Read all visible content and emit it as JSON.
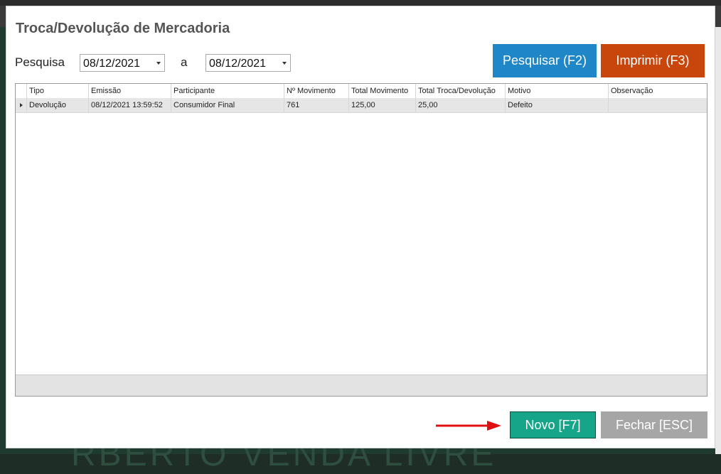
{
  "background": {
    "watermark": "RBERTO VENDA LIVRE",
    "accent": "#1f3a2e"
  },
  "dialog": {
    "title": "Troca/Devolução de Mercadoria"
  },
  "filters": {
    "search_label": "Pesquisa",
    "date_from": "08/12/2021",
    "separator": "a",
    "date_to": "08/12/2021"
  },
  "buttons": {
    "search": "Pesquisar (F2)",
    "print": "Imprimir (F3)",
    "new": "Novo [F7]",
    "close": "Fechar [ESC]"
  },
  "colors": {
    "search_button": "#1f86c8",
    "print_button": "#c8460c",
    "new_button": "#17a589",
    "close_button": "#a6a6a6",
    "arrow": "#e01010"
  },
  "grid": {
    "columns": [
      "Tipo",
      "Emissão",
      "Participante",
      "Nº Movimento",
      "Total Movimento",
      "Total Troca/Devolução",
      "Motivo",
      "Observação"
    ],
    "rows": [
      [
        "Devolução",
        "08/12/2021 13:59:52",
        "Consumidor Final",
        "761",
        "125,00",
        "25,00",
        "Defeito",
        ""
      ]
    ]
  },
  "icons": {
    "row_indicator": "triangle-right-icon",
    "dropdown": "chevron-down-icon",
    "pointer": "arrow-right-icon"
  }
}
